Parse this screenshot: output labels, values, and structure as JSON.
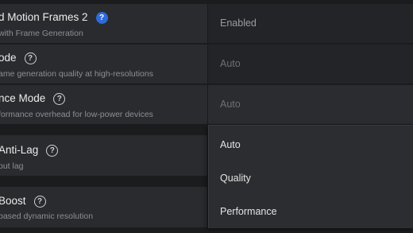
{
  "settings": [
    {
      "title": "d Motion Frames 2",
      "subtitle": "with Frame Generation",
      "help_icon": "help-icon-blue",
      "value": "Enabled"
    },
    {
      "title": "ode",
      "subtitle": "ame generation quality at high-resolutions",
      "help_icon": "help-icon",
      "value": "Auto"
    },
    {
      "title": "nce Mode",
      "subtitle": "formance overhead for low-power devices",
      "help_icon": "help-icon",
      "value": "Auto"
    },
    {
      "title": " Anti-Lag",
      "subtitle": "put lag",
      "help_icon": "help-icon",
      "value": ""
    },
    {
      "title": " Boost",
      "subtitle": " based dynamic resolution",
      "help_icon": "help-icon",
      "value": ""
    }
  ],
  "dropdown": {
    "options": [
      "Auto",
      "Quality",
      "Performance"
    ]
  },
  "colors": {
    "background": "#1b1c1e",
    "card": "#2a2b2e",
    "accent_blue": "#2f6ad8"
  }
}
